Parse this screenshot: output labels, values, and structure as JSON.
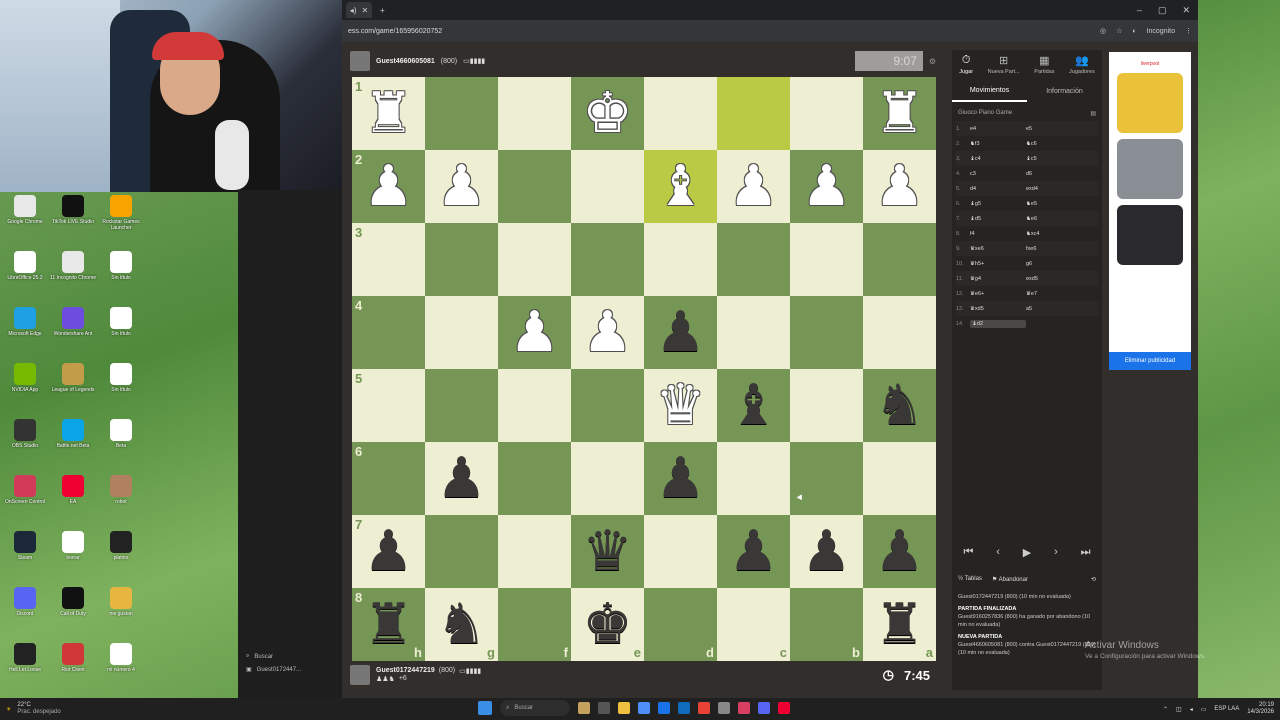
{
  "browser": {
    "url": "ess.com/game/165956020752",
    "new_tab_icon": "+",
    "incognito_label": "Incognito"
  },
  "top_player": {
    "name": "Guest4660605081",
    "rating": "(800)",
    "clock": "9:07"
  },
  "bottom_player": {
    "name": "Guest0172447219",
    "rating": "(800)",
    "captured": "+6",
    "clock": "7:45"
  },
  "board": {
    "ranks": [
      "1",
      "2",
      "3",
      "4",
      "5",
      "6",
      "7",
      "8"
    ],
    "files": [
      "h",
      "g",
      "f",
      "e",
      "d",
      "c",
      "b",
      "a"
    ],
    "rows": [
      [
        "wR",
        "",
        "",
        "wK",
        "",
        "",
        "",
        "wR"
      ],
      [
        "wP",
        "wP",
        "",
        "",
        "wB",
        "wP",
        "wP",
        "wP"
      ],
      [
        "",
        "",
        "",
        "",
        "",
        "",
        "",
        ""
      ],
      [
        "",
        "",
        "wP",
        "wP",
        "bP",
        "",
        "",
        ""
      ],
      [
        "",
        "",
        "",
        "",
        "wQ",
        "bB",
        "",
        "bN"
      ],
      [
        "",
        "bP",
        "",
        "",
        "bP",
        "",
        "",
        ""
      ],
      [
        "bP",
        "",
        "",
        "bQ",
        "",
        "bP",
        "bP",
        "bP"
      ],
      [
        "bR",
        "bN",
        "",
        "bK",
        "",
        "",
        "",
        "bR"
      ]
    ],
    "highlights": [
      [
        0,
        5,
        "hl"
      ],
      [
        1,
        4,
        "hl"
      ]
    ]
  },
  "panel": {
    "tabs": [
      {
        "icon": "⏱",
        "label": "Jugar"
      },
      {
        "icon": "⊞",
        "label": "Nueva Part..."
      },
      {
        "icon": "▦",
        "label": "Partidas"
      },
      {
        "icon": "👥",
        "label": "Jugadores"
      }
    ],
    "subtabs": [
      "Movimientos",
      "Información"
    ],
    "opening": "Giuoco Piano Game",
    "moves": [
      [
        "1.",
        "e4",
        "e5"
      ],
      [
        "2.",
        "♞f3",
        "♞c6"
      ],
      [
        "3.",
        "♝c4",
        "♝c5"
      ],
      [
        "4.",
        "c3",
        "d6"
      ],
      [
        "5.",
        "d4",
        "exd4"
      ],
      [
        "6.",
        "♝g5",
        "♞e5"
      ],
      [
        "7.",
        "♝d5",
        "♞e6"
      ],
      [
        "8.",
        "f4",
        "♞xc4"
      ],
      [
        "9.",
        "♛xe6",
        "fxe6"
      ],
      [
        "10.",
        "♛h5+",
        "g6"
      ],
      [
        "11.",
        "♛g4",
        "exd5"
      ],
      [
        "12.",
        "♛e6+",
        "♛e7"
      ],
      [
        "13.",
        "♛xd5",
        "a5"
      ],
      [
        "14.",
        "♝d2",
        ""
      ]
    ],
    "actions": {
      "draw": "Tablas",
      "resign": "Abandonar"
    },
    "log": [
      {
        "bold": false,
        "text": "Guest0172447219 (800) (10 min no evaluada)"
      },
      {
        "bold": true,
        "text": "PARTIDA FINALIZADA"
      },
      {
        "bold": false,
        "text": "Guest9160257836 (800) ha ganado por abandono (10 min no evaluada)"
      },
      {
        "bold": true,
        "text": "NUEVA PARTIDA"
      },
      {
        "bold": false,
        "text": "Guest4660605081 (800) contra Guest0172447219 (800) (10 min no evaluada)"
      }
    ]
  },
  "ad": {
    "brand": "liverpool",
    "cta": "Eliminar publicidad"
  },
  "desktop_icons": [
    {
      "label": "Google Chrome",
      "color": "#e8e8e8"
    },
    {
      "label": "TikTok LIVE Studio",
      "color": "#111"
    },
    {
      "label": "Rockstar Games Launcher",
      "color": "#f7a400"
    },
    {
      "label": "LibreOffice 25.2",
      "color": "#fff"
    },
    {
      "label": "11 Incognito Chrome",
      "color": "#e8e8e8"
    },
    {
      "label": "Sin título",
      "color": "#fff"
    },
    {
      "label": "Microsoft Edge",
      "color": "#1fa0e3"
    },
    {
      "label": "Wondershare Ant",
      "color": "#6d4de0"
    },
    {
      "label": "Sin título",
      "color": "#fff"
    },
    {
      "label": "NVIDIA App",
      "color": "#76b900"
    },
    {
      "label": "League of Legends",
      "color": "#c39c4a"
    },
    {
      "label": "Sin título",
      "color": "#fff"
    },
    {
      "label": "OBS Studio",
      "color": "#333"
    },
    {
      "label": "Battle.net Beta",
      "color": "#0aa5e8"
    },
    {
      "label": "Beta",
      "color": "#fff"
    },
    {
      "label": "OnScreen Control",
      "color": "#d23a5a"
    },
    {
      "label": "EA",
      "color": "#e03"
    },
    {
      "label": "robot",
      "color": "#b08060"
    },
    {
      "label": "Steam",
      "color": "#1b2838"
    },
    {
      "label": "borrar",
      "color": "#fff"
    },
    {
      "label": "platino",
      "color": "#222"
    },
    {
      "label": "Discord",
      "color": "#5865f2"
    },
    {
      "label": "Call of Duty",
      "color": "#111"
    },
    {
      "label": "me gustan",
      "color": "#e6b640"
    },
    {
      "label": "Hell Let Loose",
      "color": "#222"
    },
    {
      "label": "Riot Client",
      "color": "#d13639"
    },
    {
      "label": "mi número 4",
      "color": "#fff"
    }
  ],
  "sidebar": {
    "search": "Buscar",
    "user": "Guest0172447..."
  },
  "activate": {
    "title": "Activar Windows",
    "subtitle": "Ve a Configuración para activar Windows."
  },
  "taskbar": {
    "weather_temp": "22°C",
    "weather_desc": "Prac. despejado",
    "search": "Buscar",
    "lang": "ESP LAA",
    "time": "20:19",
    "date": "14/3/2026"
  },
  "colors": {
    "light_square": "#eeeed2",
    "dark_square": "#769656",
    "highlight": "#baca44",
    "panel_bg": "#262421"
  }
}
